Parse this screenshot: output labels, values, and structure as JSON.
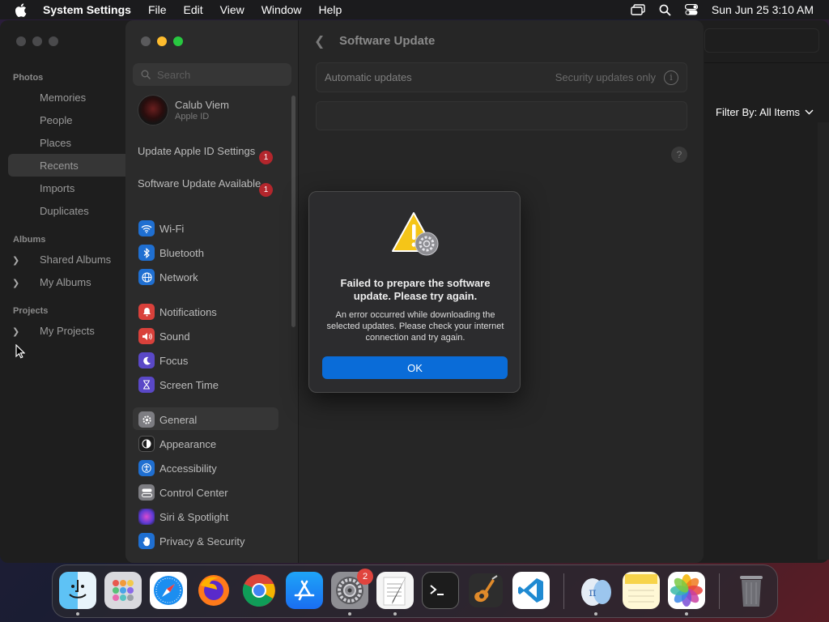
{
  "menubar": {
    "app_name": "System Settings",
    "menus": [
      "File",
      "Edit",
      "View",
      "Window",
      "Help"
    ],
    "clock": "Sun Jun 25  3:10 AM"
  },
  "photos": {
    "sections": {
      "photos": "Photos",
      "albums": "Albums",
      "projects": "Projects"
    },
    "items": {
      "memories": "Memories",
      "people": "People",
      "places": "Places",
      "recents": "Recents",
      "imports": "Imports",
      "duplicates": "Duplicates",
      "shared_albums": "Shared Albums",
      "my_albums": "My Albums",
      "my_projects": "My Projects"
    },
    "filter_label": "Filter By: All Items"
  },
  "settings": {
    "search_placeholder": "Search",
    "user": {
      "name": "Calub Viem",
      "subtitle": "Apple ID"
    },
    "alerts": [
      {
        "label": "Update Apple ID Settings",
        "badge": "1"
      },
      {
        "label": "Software Update Available",
        "badge": "1"
      }
    ],
    "nav": {
      "wifi": "Wi-Fi",
      "bluetooth": "Bluetooth",
      "network": "Network",
      "notifications": "Notifications",
      "sound": "Sound",
      "focus": "Focus",
      "screen_time": "Screen Time",
      "general": "General",
      "appearance": "Appearance",
      "accessibility": "Accessibility",
      "control_center": "Control Center",
      "siri": "Siri & Spotlight",
      "privacy": "Privacy & Security"
    },
    "page_title": "Software Update",
    "automatic_updates_label": "Automatic updates",
    "automatic_updates_value": "Security updates only",
    "help": "?"
  },
  "dialog": {
    "title": "Failed to prepare the software update. Please try again.",
    "message": "An error occurred while downloading the selected updates. Please check your internet connection and try again.",
    "ok_label": "OK"
  },
  "dock": {
    "settings_badge": "2"
  },
  "colors": {
    "accent_blue": "#0a6cd8",
    "badge_red": "#b3262c",
    "warning_yellow": "#f5c518"
  }
}
